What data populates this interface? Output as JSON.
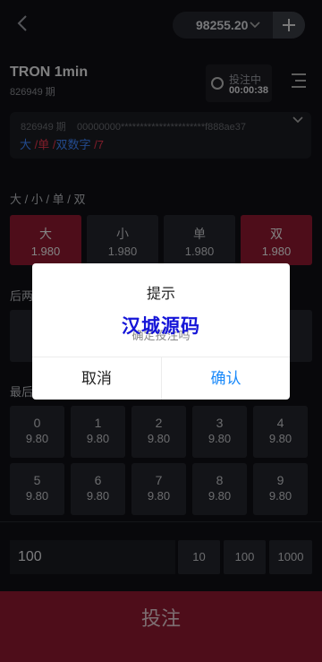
{
  "header": {
    "back_icon": "chevron-left-icon",
    "balance": "98255.20",
    "balance_dropdown_icon": "chevron-down-icon",
    "add_icon": "plus-icon"
  },
  "game": {
    "title": "TRON 1min",
    "issue": "826949 期",
    "status": "投注中",
    "countdown": "00:00:38"
  },
  "last_result": {
    "issue": "826949 期",
    "hash": "00000000**********************f888ae37",
    "parts": [
      "大",
      "单",
      "双数字",
      "7"
    ]
  },
  "size_parity": {
    "label": "大 / 小 / 单 / 双",
    "options": [
      {
        "label": "大",
        "odds": "1.980",
        "active": true
      },
      {
        "label": "小",
        "odds": "1.980",
        "active": false
      },
      {
        "label": "单",
        "odds": "1.980",
        "active": false
      },
      {
        "label": "双",
        "odds": "1.980",
        "active": true
      }
    ]
  },
  "section2": {
    "label": "后两"
  },
  "section3": {
    "label": "最后"
  },
  "numbers": [
    {
      "label": "0",
      "odds": "9.80"
    },
    {
      "label": "1",
      "odds": "9.80"
    },
    {
      "label": "2",
      "odds": "9.80"
    },
    {
      "label": "3",
      "odds": "9.80"
    },
    {
      "label": "4",
      "odds": "9.80"
    },
    {
      "label": "5",
      "odds": "9.80"
    },
    {
      "label": "6",
      "odds": "9.80"
    },
    {
      "label": "7",
      "odds": "9.80"
    },
    {
      "label": "8",
      "odds": "9.80"
    },
    {
      "label": "9",
      "odds": "9.80"
    }
  ],
  "bet": {
    "amount": "100",
    "quick_amounts": [
      "10",
      "100",
      "1000"
    ],
    "submit_label": "投注"
  },
  "dialog": {
    "title": "提示",
    "message": "确定投注吗",
    "watermark": "汉城源码",
    "cancel_label": "取消",
    "confirm_label": "确认"
  },
  "colors": {
    "accent": "#8e1930",
    "blue": "#3e86ff",
    "red": "#e8364d",
    "confirm": "#1989fa"
  }
}
